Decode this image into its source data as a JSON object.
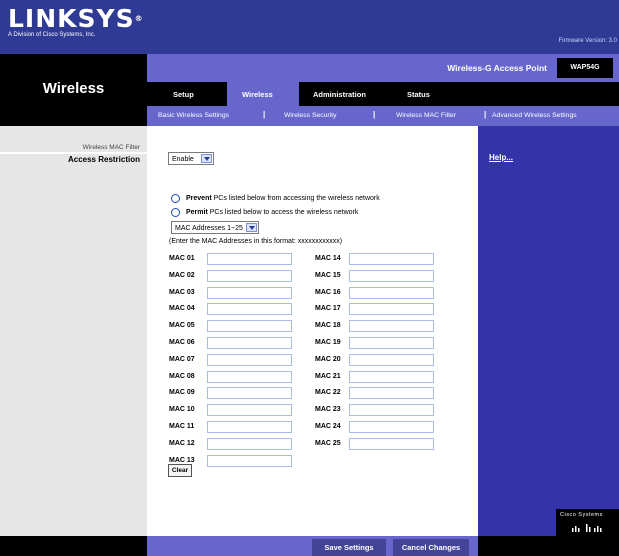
{
  "brand": {
    "logo": "LINKSYS",
    "reg": "®",
    "subtitle": "A Division of Cisco Systems, Inc."
  },
  "firmware": "Firmware Version: 3.0",
  "section_title": "Wireless",
  "product_name": "Wireless-G Access Point",
  "model": "WAP54G",
  "tabs": [
    "Setup",
    "Wireless",
    "Administration",
    "Status"
  ],
  "active_tab": "Wireless",
  "subtabs": [
    "Basic Wireless Settings",
    "Wireless Security",
    "Wireless MAC Filter",
    "Advanced Wireless Settings"
  ],
  "left": {
    "header": "Wireless MAC Filter",
    "label": "Access Restriction"
  },
  "restriction_select": "Enable",
  "prevent_text": {
    "bold": "Prevent",
    "rest": "PCs listed below from accessing the wireless network"
  },
  "permit_text": {
    "bold": "Permit",
    "rest": "PCs listed below to access the wireless network"
  },
  "mac_range_select": "MAC Addresses 1~25",
  "format_hint": "(Enter the MAC Addresses in this format: xxxxxxxxxxxx)",
  "mac_left": [
    "MAC 01",
    "MAC 02",
    "MAC 03",
    "MAC 04",
    "MAC 05",
    "MAC 06",
    "MAC 07",
    "MAC 08",
    "MAC 09",
    "MAC 10",
    "MAC 11",
    "MAC 12",
    "MAC 13"
  ],
  "mac_right": [
    "MAC 14",
    "MAC 15",
    "MAC 16",
    "MAC 17",
    "MAC 18",
    "MAC 19",
    "MAC 20",
    "MAC 21",
    "MAC 22",
    "MAC 23",
    "MAC 24",
    "MAC 25"
  ],
  "clear_label": "Clear",
  "help_link": "Help...",
  "cisco_label": "Cisco Systems",
  "save_label": "Save Settings",
  "cancel_label": "Cancel Changes",
  "colors": {
    "banner": "#2e3a93",
    "accent": "#6666cc",
    "help_panel": "#3333aa"
  }
}
